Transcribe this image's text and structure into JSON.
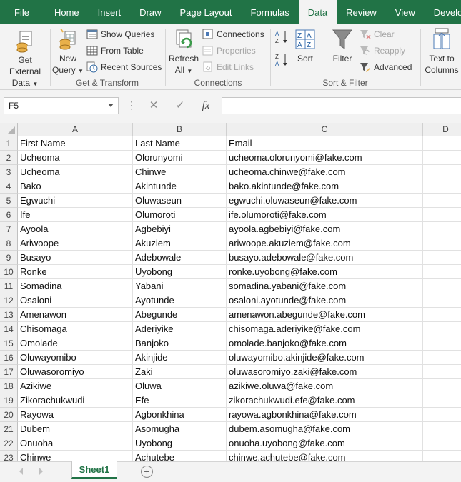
{
  "tabs": [
    "File",
    "Home",
    "Insert",
    "Draw",
    "Page Layout",
    "Formulas",
    "Data",
    "Review",
    "View",
    "Develope"
  ],
  "active_tab": "Data",
  "ribbon": {
    "get_external": {
      "line1": "Get External",
      "line2": "Data"
    },
    "new_query": {
      "line1": "New",
      "line2": "Query"
    },
    "show_queries": "Show Queries",
    "from_table": "From Table",
    "recent_sources": "Recent Sources",
    "get_transform_label": "Get & Transform",
    "refresh_all": {
      "line1": "Refresh",
      "line2": "All"
    },
    "connections": "Connections",
    "properties": "Properties",
    "edit_links": "Edit Links",
    "connections_label": "Connections",
    "sort_az": "A↓Z",
    "sort_za": "Z↓A",
    "sort": "Sort",
    "filter": "Filter",
    "clear": "Clear",
    "reapply": "Reapply",
    "advanced": "Advanced",
    "sort_filter_label": "Sort & Filter",
    "text_to_columns": {
      "line1": "Text to",
      "line2": "Columns"
    }
  },
  "formula_bar": {
    "name_box": "F5",
    "cancel": "✕",
    "enter": "✓",
    "fx": "fx",
    "value": ""
  },
  "columns": [
    "A",
    "B",
    "C",
    "D"
  ],
  "rows": [
    {
      "n": "1",
      "a": "First Name",
      "b": "Last Name",
      "c": "Email"
    },
    {
      "n": "2",
      "a": "Ucheoma",
      "b": "Olorunyomi",
      "c": "ucheoma.olorunyomi@fake.com"
    },
    {
      "n": "3",
      "a": "Ucheoma",
      "b": "Chinwe",
      "c": "ucheoma.chinwe@fake.com"
    },
    {
      "n": "4",
      "a": "Bako",
      "b": "Akintunde",
      "c": "bako.akintunde@fake.com"
    },
    {
      "n": "5",
      "a": "Egwuchi",
      "b": "Oluwaseun",
      "c": "egwuchi.oluwaseun@fake.com"
    },
    {
      "n": "6",
      "a": "Ife",
      "b": "Olumoroti",
      "c": "ife.olumoroti@fake.com"
    },
    {
      "n": "7",
      "a": "Ayoola",
      "b": "Agbebiyi",
      "c": "ayoola.agbebiyi@fake.com"
    },
    {
      "n": "8",
      "a": "Ariwoope",
      "b": "Akuziem",
      "c": "ariwoope.akuziem@fake.com"
    },
    {
      "n": "9",
      "a": "Busayo",
      "b": "Adebowale",
      "c": "busayo.adebowale@fake.com"
    },
    {
      "n": "10",
      "a": "Ronke",
      "b": "Uyobong",
      "c": "ronke.uyobong@fake.com"
    },
    {
      "n": "11",
      "a": "Somadina",
      "b": "Yabani",
      "c": "somadina.yabani@fake.com"
    },
    {
      "n": "12",
      "a": "Osaloni",
      "b": "Ayotunde",
      "c": "osaloni.ayotunde@fake.com"
    },
    {
      "n": "13",
      "a": "Amenawon",
      "b": "Abegunde",
      "c": "amenawon.abegunde@fake.com"
    },
    {
      "n": "14",
      "a": "Chisomaga",
      "b": "Aderiyike",
      "c": "chisomaga.aderiyike@fake.com"
    },
    {
      "n": "15",
      "a": "Omolade",
      "b": "Banjoko",
      "c": "omolade.banjoko@fake.com"
    },
    {
      "n": "16",
      "a": "Oluwayomibo",
      "b": "Akinjide",
      "c": "oluwayomibo.akinjide@fake.com"
    },
    {
      "n": "17",
      "a": "Oluwasoromiyo",
      "b": "Zaki",
      "c": "oluwasoromiyo.zaki@fake.com"
    },
    {
      "n": "18",
      "a": "Azikiwe",
      "b": "Oluwa",
      "c": "azikiwe.oluwa@fake.com"
    },
    {
      "n": "19",
      "a": "Zikorachukwudi",
      "b": "Efe",
      "c": "zikorachukwudi.efe@fake.com"
    },
    {
      "n": "20",
      "a": "Rayowa",
      "b": "Agbonkhina",
      "c": "rayowa.agbonkhina@fake.com"
    },
    {
      "n": "21",
      "a": "Dubem",
      "b": "Asomugha",
      "c": "dubem.asomugha@fake.com"
    },
    {
      "n": "22",
      "a": "Onuoha",
      "b": "Uyobong",
      "c": "onuoha.uyobong@fake.com"
    },
    {
      "n": "23",
      "a": "Chinwe",
      "b": "Achutebe",
      "c": "chinwe.achutebe@fake.com"
    }
  ],
  "sheet_tab": "Sheet1",
  "add_sheet": "+",
  "colors": {
    "accent": "#217346",
    "ribbon_bg": "#f3f3f3",
    "header_bg": "#efefef"
  }
}
